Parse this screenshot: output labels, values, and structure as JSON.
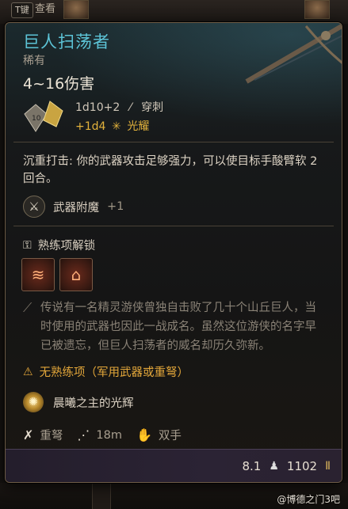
{
  "background": {
    "hotkey": "T键",
    "look_label": "查看"
  },
  "tooltip": {
    "title": "巨人扫荡者",
    "rarity": "稀有",
    "damage_range": "4~16伤害",
    "damage_primary": {
      "dice": "1d10+2",
      "type": "穿刺"
    },
    "damage_bonus": {
      "dice": "+1d4",
      "type": "光耀"
    },
    "description": "沉重打击: 你的武器攻击足够强力，可以使目标手酸臂软 2回合。",
    "enchant": {
      "label": "武器附魔",
      "value": "+1"
    },
    "proficiency_unlock_label": "熟练项解锁",
    "lore": "传说有一名精灵游侠曾独自击败了几十个山丘巨人，当时使用的武器也因此一战成名。虽然这位游侠的名字早已被遗忘，但巨人扫荡者的威名却历久弥新。",
    "warning": "无熟练项（军用武器或重弩）",
    "passive": "晨曦之主的光辉",
    "properties": {
      "weapon_type": "重弩",
      "range": "18m",
      "handedness": "双手"
    },
    "weight": "8.1",
    "value": "1102"
  },
  "watermark": "@博德之门3吧",
  "colors": {
    "title": "#5cc3d6",
    "radiant": "#e2b23c",
    "warning": "#e3a73a",
    "footer": "#2b2334"
  },
  "icons": [
    "weapon-art-icon",
    "dice-icon",
    "pierce-icon",
    "radiant-icon",
    "enchant-icon",
    "unlock-icon",
    "action-icon",
    "lore-icon",
    "warning-icon",
    "passive-sun-icon",
    "crossbow-icon",
    "range-icon",
    "hand-icon",
    "weight-icon",
    "coin-icon"
  ]
}
